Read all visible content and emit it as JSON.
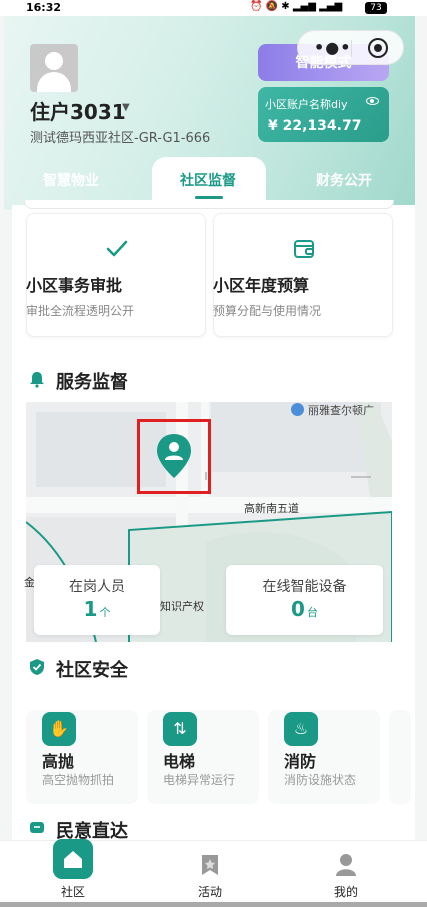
{
  "status_bar": {
    "time": "16:32",
    "battery": "73"
  },
  "colors": {
    "accent": "#1a9a86",
    "smart_mode": "#9c8ded",
    "alert_box": "#e02020"
  },
  "header": {
    "resident_name": "住户3031",
    "community": "测试德玛西亚社区-GR-G1-666",
    "smart_mode_label": "智能模式",
    "account_label": "小区账户名称diy",
    "account_balance": "¥ 22,134.77"
  },
  "tabs": [
    {
      "label": "智慧物业",
      "active": false
    },
    {
      "label": "社区监督",
      "active": true
    },
    {
      "label": "财务公开",
      "active": false
    }
  ],
  "cards": [
    {
      "icon": "check-icon",
      "title": "小区事务审批",
      "subtitle": "审批全流程透明公开"
    },
    {
      "icon": "wallet-icon",
      "title": "小区年度预算",
      "subtitle": "预算分配与使用情况"
    }
  ],
  "service": {
    "title": "服务监督",
    "map": {
      "poi": "丽雅查尔顿广",
      "road": "高新南五道",
      "ip_label": "知识产权",
      "edge_char": "金"
    },
    "stats": [
      {
        "label": "在岗人员",
        "value": "1",
        "unit": "个"
      },
      {
        "label": "在线智能设备",
        "value": "0",
        "unit": "台"
      }
    ]
  },
  "safety": {
    "title": "社区安全",
    "tiles": [
      {
        "icon": "high-throw-icon",
        "title": "高抛",
        "subtitle": "高空抛物抓拍"
      },
      {
        "icon": "elevator-icon",
        "title": "电梯",
        "subtitle": "电梯异常运行"
      },
      {
        "icon": "fire-icon",
        "title": "消防",
        "subtitle": "消防设施状态"
      }
    ]
  },
  "next_section": {
    "title": "民意直达"
  },
  "tabbar": [
    {
      "label": "社区",
      "active": true
    },
    {
      "label": "活动",
      "active": false
    },
    {
      "label": "我的",
      "active": false
    }
  ]
}
